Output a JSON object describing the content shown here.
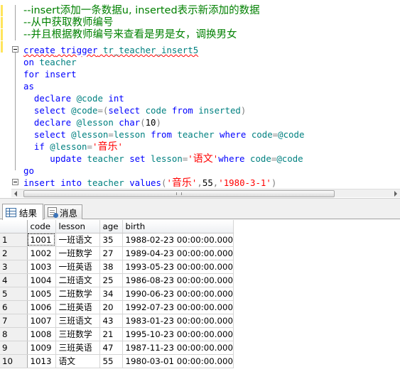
{
  "editor": {
    "lines": [
      {
        "zh": true,
        "tokens": [
          {
            "t": "--insert添加一条数据u, inserted表示新添加的数据",
            "c": "cm"
          }
        ]
      },
      {
        "zh": true,
        "tokens": [
          {
            "t": "--从中获取教师编号",
            "c": "cm"
          }
        ]
      },
      {
        "zh": true,
        "tokens": [
          {
            "t": "--并且根据教师编号来查看是男是女，调换男女",
            "c": "cm"
          }
        ]
      },
      {
        "tokens": [
          {
            "t": "create",
            "c": "kw"
          },
          {
            "t": " ",
            "c": "nm"
          },
          {
            "t": "trigger",
            "c": "kw"
          },
          {
            "t": " tr_teacher_insert5",
            "c": "id"
          }
        ],
        "squiggle": true
      },
      {
        "tokens": [
          {
            "t": "on",
            "c": "kw"
          },
          {
            "t": " teacher",
            "c": "id"
          }
        ]
      },
      {
        "tokens": [
          {
            "t": "for",
            "c": "kw"
          },
          {
            "t": " ",
            "c": "nm"
          },
          {
            "t": "insert",
            "c": "kw"
          }
        ]
      },
      {
        "tokens": [
          {
            "t": "as",
            "c": "kw"
          }
        ]
      },
      {
        "tokens": [
          {
            "t": "  declare",
            "c": "kw"
          },
          {
            "t": " @code ",
            "c": "id"
          },
          {
            "t": "int",
            "c": "kw"
          }
        ]
      },
      {
        "tokens": [
          {
            "t": "  select",
            "c": "kw"
          },
          {
            "t": " @code",
            "c": "id"
          },
          {
            "t": "=(",
            "c": "gr"
          },
          {
            "t": "select",
            "c": "kw"
          },
          {
            "t": " code ",
            "c": "id"
          },
          {
            "t": "from",
            "c": "kw"
          },
          {
            "t": " inserted",
            "c": "id"
          },
          {
            "t": ")",
            "c": "gr"
          }
        ]
      },
      {
        "tokens": [
          {
            "t": "  declare",
            "c": "kw"
          },
          {
            "t": " @lesson ",
            "c": "id"
          },
          {
            "t": "char",
            "c": "kw"
          },
          {
            "t": "(",
            "c": "gr"
          },
          {
            "t": "10",
            "c": "nm"
          },
          {
            "t": ")",
            "c": "gr"
          }
        ]
      },
      {
        "tokens": [
          {
            "t": "  select",
            "c": "kw"
          },
          {
            "t": " @lesson",
            "c": "id"
          },
          {
            "t": "=",
            "c": "gr"
          },
          {
            "t": "lesson ",
            "c": "id"
          },
          {
            "t": "from",
            "c": "kw"
          },
          {
            "t": " teacher ",
            "c": "id"
          },
          {
            "t": "where",
            "c": "kw"
          },
          {
            "t": " code",
            "c": "id"
          },
          {
            "t": "=",
            "c": "gr"
          },
          {
            "t": "@code",
            "c": "id"
          }
        ]
      },
      {
        "tokens": [
          {
            "t": "  if",
            "c": "kw"
          },
          {
            "t": " @lesson",
            "c": "id"
          },
          {
            "t": "=",
            "c": "gr"
          },
          {
            "t": "'",
            "c": "st"
          },
          {
            "t": "音乐",
            "c": "zhs"
          },
          {
            "t": "'",
            "c": "st"
          }
        ]
      },
      {
        "tokens": [
          {
            "t": "     update",
            "c": "kw"
          },
          {
            "t": " teacher ",
            "c": "id"
          },
          {
            "t": "set",
            "c": "kw"
          },
          {
            "t": " lesson",
            "c": "id"
          },
          {
            "t": "=",
            "c": "gr"
          },
          {
            "t": "'",
            "c": "st"
          },
          {
            "t": "语文",
            "c": "zhs"
          },
          {
            "t": "'",
            "c": "st"
          },
          {
            "t": "where",
            "c": "kw"
          },
          {
            "t": " code",
            "c": "id"
          },
          {
            "t": "=",
            "c": "gr"
          },
          {
            "t": "@code",
            "c": "id"
          }
        ]
      },
      {
        "tokens": [
          {
            "t": "go",
            "c": "kw"
          }
        ]
      },
      {
        "tokens": [
          {
            "t": "insert",
            "c": "kw"
          },
          {
            "t": " ",
            "c": "nm"
          },
          {
            "t": "into",
            "c": "kw"
          },
          {
            "t": " teacher ",
            "c": "id"
          },
          {
            "t": "values",
            "c": "kw"
          },
          {
            "t": "(",
            "c": "gr"
          },
          {
            "t": "'",
            "c": "st"
          },
          {
            "t": "音乐",
            "c": "zhs"
          },
          {
            "t": "'",
            "c": "st"
          },
          {
            "t": ",",
            "c": "gr"
          },
          {
            "t": "55",
            "c": "nm"
          },
          {
            "t": ",",
            "c": "gr"
          },
          {
            "t": "'1980-3-1'",
            "c": "st"
          },
          {
            "t": ")",
            "c": "gr"
          }
        ]
      }
    ]
  },
  "tabs": {
    "results_label": "结果",
    "messages_label": "消息"
  },
  "results": {
    "columns": [
      "code",
      "lesson",
      "age",
      "birth"
    ],
    "rows": [
      {
        "num": "1",
        "cells": [
          "1001",
          "一班语文",
          "35",
          "1988-02-23 00:00:00.000"
        ]
      },
      {
        "num": "2",
        "cells": [
          "1002",
          "一班数学",
          "27",
          "1989-04-23 00:00:00.000"
        ]
      },
      {
        "num": "3",
        "cells": [
          "1003",
          "一班英语",
          "38",
          "1993-05-23 00:00:00.000"
        ]
      },
      {
        "num": "4",
        "cells": [
          "1004",
          "二班语文",
          "25",
          "1986-08-23 00:00:00.000"
        ]
      },
      {
        "num": "5",
        "cells": [
          "1005",
          "二班数学",
          "34",
          "1990-06-23 00:00:00.000"
        ]
      },
      {
        "num": "6",
        "cells": [
          "1006",
          "二班英语",
          "20",
          "1992-07-23 00:00:00.000"
        ]
      },
      {
        "num": "7",
        "cells": [
          "1007",
          "三班语文",
          "43",
          "1983-01-23 00:00:00.000"
        ]
      },
      {
        "num": "8",
        "cells": [
          "1008",
          "三班数学",
          "21",
          "1995-10-23 00:00:00.000"
        ]
      },
      {
        "num": "9",
        "cells": [
          "1009",
          "三班英语",
          "47",
          "1987-11-23 00:00:00.000"
        ]
      },
      {
        "num": "10",
        "cells": [
          "1013",
          "语文",
          "55",
          "1980-03-01 00:00:00.000"
        ]
      }
    ]
  }
}
